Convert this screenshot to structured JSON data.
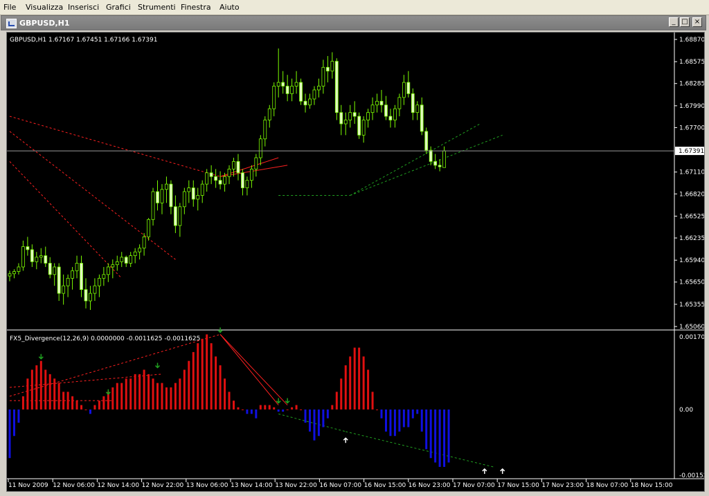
{
  "menu": [
    "File",
    "Visualizza",
    "Inserisci",
    "Grafici",
    "Strumenti",
    "Finestra",
    "Aiuto"
  ],
  "window": {
    "title": "GBPUSD,H1",
    "buttons": [
      "_",
      "□",
      "×"
    ]
  },
  "price_panel": {
    "header": "GBPUSD,H1  1.67167 1.67451 1.67166 1.67391",
    "current_price": "1.67391",
    "axis_labels": [
      "1.68870",
      "1.68575",
      "1.68285",
      "1.67990",
      "1.67700",
      "1.67110",
      "1.66820",
      "1.66525",
      "1.66235",
      "1.65940",
      "1.65650",
      "1.65355",
      "1.65060"
    ]
  },
  "indicator_panel": {
    "header": "FX5_Divergence(12,26,9) 0.0000000 -0.0011625 -0.0011625",
    "axis_labels": [
      "0.001706",
      "0.00",
      "-0.00152"
    ]
  },
  "time_axis": [
    "11 Nov 2009",
    "12 Nov 06:00",
    "12 Nov 14:00",
    "12 Nov 22:00",
    "13 Nov 06:00",
    "13 Nov 14:00",
    "13 Nov 22:00",
    "16 Nov 07:00",
    "16 Nov 15:00",
    "16 Nov 23:00",
    "17 Nov 07:00",
    "17 Nov 15:00",
    "17 Nov 23:00",
    "18 Nov 07:00",
    "18 Nov 15:00"
  ],
  "colors": {
    "bull": "#000000",
    "bear": "#e0f8c0",
    "wick": "#7cfc00",
    "hist_pos": "#e01010",
    "hist_neg": "#1010e0",
    "bear_div": "#ff2020",
    "bull_div": "#20a020"
  },
  "chart_data": {
    "type": "candlestick",
    "symbol": "GBPUSD",
    "timeframe": "H1",
    "ylim": [
      1.6506,
      1.6887
    ],
    "candles": [
      [
        1.6573,
        1.658,
        1.6566,
        1.6576
      ],
      [
        1.6576,
        1.6582,
        1.657,
        1.6579
      ],
      [
        1.6579,
        1.659,
        1.6575,
        1.6585
      ],
      [
        1.6585,
        1.662,
        1.658,
        1.6612
      ],
      [
        1.6612,
        1.6625,
        1.66,
        1.6608
      ],
      [
        1.6608,
        1.6615,
        1.6585,
        1.6592
      ],
      [
        1.6592,
        1.6605,
        1.6582,
        1.6598
      ],
      [
        1.6598,
        1.661,
        1.659,
        1.66
      ],
      [
        1.66,
        1.6612,
        1.6585,
        1.659
      ],
      [
        1.659,
        1.6598,
        1.657,
        1.6575
      ],
      [
        1.6575,
        1.659,
        1.656,
        1.6585
      ],
      [
        1.6585,
        1.659,
        1.654,
        1.655
      ],
      [
        1.655,
        1.6575,
        1.6535,
        1.656
      ],
      [
        1.656,
        1.6575,
        1.6545,
        1.657
      ],
      [
        1.657,
        1.6585,
        1.6555,
        1.658
      ],
      [
        1.658,
        1.66,
        1.657,
        1.659
      ],
      [
        1.659,
        1.66,
        1.6545,
        1.6555
      ],
      [
        1.6555,
        1.657,
        1.653,
        1.654
      ],
      [
        1.654,
        1.656,
        1.6528,
        1.655
      ],
      [
        1.655,
        1.657,
        1.654,
        1.656
      ],
      [
        1.656,
        1.6575,
        1.6545,
        1.657
      ],
      [
        1.657,
        1.6585,
        1.656,
        1.6575
      ],
      [
        1.6575,
        1.659,
        1.6565,
        1.6585
      ],
      [
        1.6585,
        1.6595,
        1.657,
        1.6588
      ],
      [
        1.6588,
        1.66,
        1.658,
        1.6592
      ],
      [
        1.6592,
        1.6605,
        1.6585,
        1.6598
      ],
      [
        1.6598,
        1.66,
        1.6585,
        1.659
      ],
      [
        1.659,
        1.6605,
        1.6585,
        1.66
      ],
      [
        1.66,
        1.661,
        1.659,
        1.6605
      ],
      [
        1.6605,
        1.6615,
        1.6595,
        1.661
      ],
      [
        1.661,
        1.663,
        1.66,
        1.6625
      ],
      [
        1.6625,
        1.665,
        1.662,
        1.6648
      ],
      [
        1.6648,
        1.669,
        1.664,
        1.6685
      ],
      [
        1.6685,
        1.67,
        1.666,
        1.667
      ],
      [
        1.667,
        1.6695,
        1.6655,
        1.6688
      ],
      [
        1.6688,
        1.6705,
        1.667,
        1.6695
      ],
      [
        1.6695,
        1.67,
        1.6655,
        1.6665
      ],
      [
        1.6665,
        1.668,
        1.663,
        1.664
      ],
      [
        1.664,
        1.667,
        1.6625,
        1.6665
      ],
      [
        1.6665,
        1.669,
        1.6655,
        1.6685
      ],
      [
        1.6685,
        1.67,
        1.667,
        1.669
      ],
      [
        1.669,
        1.67,
        1.6665,
        1.6675
      ],
      [
        1.6675,
        1.669,
        1.666,
        1.668
      ],
      [
        1.668,
        1.67,
        1.667,
        1.6695
      ],
      [
        1.6695,
        1.6715,
        1.6685,
        1.671
      ],
      [
        1.671,
        1.672,
        1.6695,
        1.6705
      ],
      [
        1.6705,
        1.6715,
        1.669,
        1.67
      ],
      [
        1.67,
        1.6712,
        1.6688,
        1.6695
      ],
      [
        1.6695,
        1.671,
        1.6685,
        1.6705
      ],
      [
        1.6705,
        1.672,
        1.6695,
        1.6715
      ],
      [
        1.6715,
        1.673,
        1.6705,
        1.6725
      ],
      [
        1.6725,
        1.6735,
        1.67,
        1.671
      ],
      [
        1.671,
        1.6715,
        1.668,
        1.669
      ],
      [
        1.669,
        1.6705,
        1.668,
        1.67
      ],
      [
        1.67,
        1.672,
        1.669,
        1.6715
      ],
      [
        1.6715,
        1.6735,
        1.6705,
        1.673
      ],
      [
        1.673,
        1.676,
        1.672,
        1.6755
      ],
      [
        1.6755,
        1.6785,
        1.6745,
        1.678
      ],
      [
        1.678,
        1.68,
        1.677,
        1.6795
      ],
      [
        1.6795,
        1.683,
        1.6785,
        1.6825
      ],
      [
        1.6825,
        1.6875,
        1.681,
        1.683
      ],
      [
        1.683,
        1.6845,
        1.6815,
        1.6825
      ],
      [
        1.6825,
        1.684,
        1.6805,
        1.6815
      ],
      [
        1.6815,
        1.6835,
        1.6805,
        1.6825
      ],
      [
        1.6825,
        1.6845,
        1.6815,
        1.683
      ],
      [
        1.683,
        1.6835,
        1.68,
        1.6805
      ],
      [
        1.6805,
        1.6815,
        1.679,
        1.68
      ],
      [
        1.68,
        1.6815,
        1.6795,
        1.6808
      ],
      [
        1.6808,
        1.6825,
        1.68,
        1.682
      ],
      [
        1.682,
        1.6835,
        1.681,
        1.6825
      ],
      [
        1.6825,
        1.686,
        1.6815,
        1.685
      ],
      [
        1.685,
        1.6865,
        1.683,
        1.6845
      ],
      [
        1.6845,
        1.687,
        1.6835,
        1.6858
      ],
      [
        1.6858,
        1.6862,
        1.678,
        1.679
      ],
      [
        1.679,
        1.68,
        1.676,
        1.6775
      ],
      [
        1.6775,
        1.679,
        1.676,
        1.678
      ],
      [
        1.678,
        1.68,
        1.677,
        1.679
      ],
      [
        1.679,
        1.6805,
        1.6775,
        1.6785
      ],
      [
        1.6785,
        1.679,
        1.6755,
        1.676
      ],
      [
        1.676,
        1.6785,
        1.675,
        1.678
      ],
      [
        1.678,
        1.6795,
        1.677,
        1.679
      ],
      [
        1.679,
        1.681,
        1.678,
        1.68
      ],
      [
        1.68,
        1.6815,
        1.679,
        1.6805
      ],
      [
        1.6805,
        1.682,
        1.679,
        1.68
      ],
      [
        1.68,
        1.6812,
        1.678,
        1.6785
      ],
      [
        1.6785,
        1.6795,
        1.677,
        1.678
      ],
      [
        1.678,
        1.68,
        1.677,
        1.6795
      ],
      [
        1.6795,
        1.6815,
        1.6785,
        1.681
      ],
      [
        1.681,
        1.684,
        1.68,
        1.683
      ],
      [
        1.683,
        1.6845,
        1.681,
        1.6815
      ],
      [
        1.6815,
        1.6822,
        1.678,
        1.679
      ],
      [
        1.679,
        1.6805,
        1.678,
        1.68
      ],
      [
        1.68,
        1.681,
        1.676,
        1.6765
      ],
      [
        1.6765,
        1.677,
        1.6735,
        1.674
      ],
      [
        1.674,
        1.6745,
        1.672,
        1.6725
      ],
      [
        1.6725,
        1.6735,
        1.6715,
        1.672
      ],
      [
        1.672,
        1.6728,
        1.6712,
        1.6718
      ],
      [
        1.6717,
        1.6745,
        1.6717,
        1.6739
      ]
    ],
    "histogram": [
      -0.0011,
      -0.0006,
      -0.0003,
      0.0003,
      0.0007,
      0.0009,
      0.001,
      0.0011,
      0.0009,
      0.0008,
      0.0007,
      0.0006,
      0.0004,
      0.0004,
      0.0003,
      0.0002,
      0.0001,
      0.0,
      -0.0001,
      0.0001,
      0.0002,
      0.0003,
      0.0004,
      0.0005,
      0.0006,
      0.0006,
      0.0007,
      0.0007,
      0.0008,
      0.0008,
      0.0009,
      0.0008,
      0.0007,
      0.0006,
      0.0006,
      0.0005,
      0.0005,
      0.0006,
      0.0007,
      0.0009,
      0.0011,
      0.0013,
      0.0015,
      0.0016,
      0.0017,
      0.0015,
      0.0012,
      0.001,
      0.0007,
      0.0004,
      0.0002,
      5e-05,
      0.0,
      -0.0001,
      -0.0001,
      -0.0002,
      0.0001,
      0.0001,
      0.0001,
      5e-05,
      -5e-05,
      -5e-05,
      0.0,
      5e-05,
      0.0001,
      0.0,
      -0.0003,
      -0.0005,
      -0.0007,
      -0.0006,
      -0.0004,
      -0.0002,
      0.0001,
      0.0004,
      0.0007,
      0.001,
      0.0012,
      0.0014,
      0.0014,
      0.0012,
      0.0009,
      0.0004,
      0.0,
      -0.0002,
      -0.0005,
      -0.0006,
      -0.0006,
      -0.0005,
      -0.0004,
      -0.0004,
      -0.0002,
      -0.0001,
      -0.0005,
      -0.0009,
      -0.0011,
      -0.0012,
      -0.0013,
      -0.0013,
      -0.0012
    ]
  }
}
